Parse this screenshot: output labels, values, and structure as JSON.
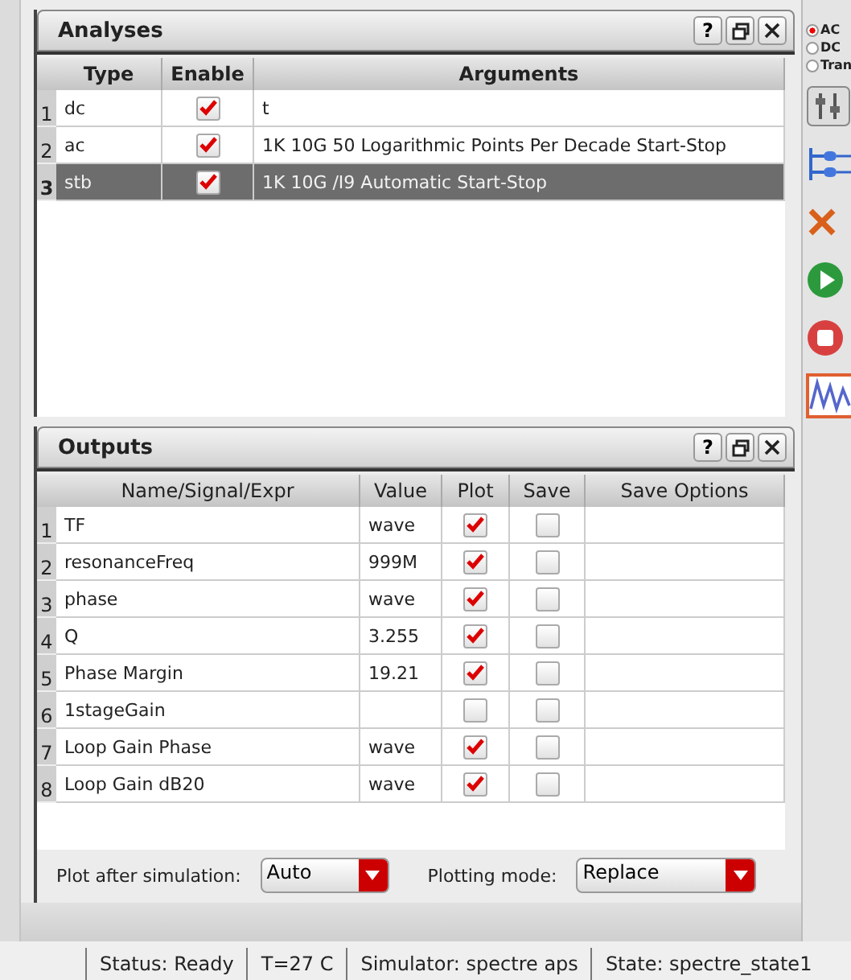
{
  "analyses": {
    "title": "Analyses",
    "help": "?",
    "columns": [
      "Type",
      "Enable",
      "Arguments"
    ],
    "rows": [
      {
        "number": "1",
        "type": "dc",
        "enabled": true,
        "arguments": "t",
        "selected": false
      },
      {
        "number": "2",
        "type": "ac",
        "enabled": true,
        "arguments": "1K 10G 50 Logarithmic Points Per Decade Start-Stop",
        "selected": false
      },
      {
        "number": "3",
        "type": "stb",
        "enabled": true,
        "arguments": "1K 10G /I9 Automatic Start-Stop",
        "selected": true
      }
    ]
  },
  "outputs": {
    "title": "Outputs",
    "help": "?",
    "columns": [
      "Name/Signal/Expr",
      "Value",
      "Plot",
      "Save",
      "Save Options"
    ],
    "rows": [
      {
        "number": "1",
        "name": "TF",
        "value": "wave",
        "plot": true,
        "save": false
      },
      {
        "number": "2",
        "name": "resonanceFreq",
        "value": "999M",
        "plot": true,
        "save": false
      },
      {
        "number": "3",
        "name": "phase",
        "value": "wave",
        "plot": true,
        "save": false
      },
      {
        "number": "4",
        "name": "Q",
        "value": "3.255",
        "plot": true,
        "save": false
      },
      {
        "number": "5",
        "name": "Phase Margin",
        "value": "19.21",
        "plot": true,
        "save": false
      },
      {
        "number": "6",
        "name": "1stageGain",
        "value": "",
        "plot": false,
        "save": false
      },
      {
        "number": "7",
        "name": "Loop Gain Phase",
        "value": "wave",
        "plot": true,
        "save": false
      },
      {
        "number": "8",
        "name": "Loop Gain dB20",
        "value": "wave",
        "plot": true,
        "save": false
      }
    ]
  },
  "plot_after_simulation": {
    "label": "Plot after simulation:",
    "value": "Auto"
  },
  "plotting_mode": {
    "label": "Plotting mode:",
    "value": "Replace"
  },
  "toolbar": {
    "radios": [
      {
        "label": "AC",
        "selected": true
      },
      {
        "label": "DC",
        "selected": false
      },
      {
        "label": "Tran",
        "selected": false
      }
    ],
    "buttons": [
      {
        "kind": "settings"
      },
      {
        "kind": "network"
      },
      {
        "kind": "delete"
      },
      {
        "kind": "run"
      },
      {
        "kind": "stop"
      },
      {
        "kind": "waveform"
      }
    ]
  },
  "status_bar": [
    "Status: Ready",
    "T=27 C",
    "Simulator: spectre aps",
    "State: spectre_state1"
  ]
}
